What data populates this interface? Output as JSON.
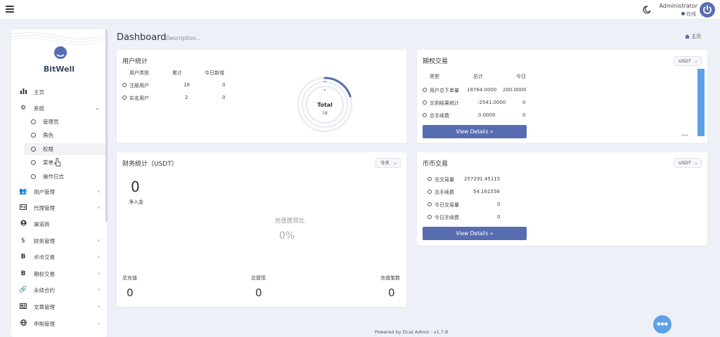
{
  "header": {
    "user_name": "Administrator",
    "user_status": "在线"
  },
  "sidebar": {
    "brand": "BitWell",
    "items": [
      {
        "icon": "bar-chart-icon",
        "label": "主页"
      },
      {
        "icon": "gear-icon",
        "label": "系统"
      },
      {
        "icon": "users-icon",
        "label": "用户管理"
      },
      {
        "icon": "id-card-icon",
        "label": "代理管理"
      },
      {
        "icon": "user-circle-icon",
        "label": "渠道商"
      },
      {
        "icon": "dollar-icon",
        "label": "财务管理"
      },
      {
        "icon": "bitcoin-icon",
        "label": "币币交易"
      },
      {
        "icon": "bitcoin-icon",
        "label": "期权交易"
      },
      {
        "icon": "link-icon",
        "label": "永续合约"
      },
      {
        "icon": "newspaper-icon",
        "label": "文章管理"
      },
      {
        "icon": "globe-icon",
        "label": "申购管理"
      }
    ],
    "sub_items": [
      {
        "label": "管理员"
      },
      {
        "label": "角色"
      },
      {
        "label": "权限"
      },
      {
        "label": "菜单"
      },
      {
        "label": "操作日志"
      }
    ]
  },
  "page": {
    "title": "Dashboard",
    "description": "Description...",
    "breadcrumb": "主页"
  },
  "user_stats": {
    "title": "用户统计",
    "headers": [
      "用户类型",
      "累计",
      "今日新增"
    ],
    "rows": [
      {
        "type": "注册用户",
        "total": "18",
        "today": "0"
      },
      {
        "type": "实名用户",
        "total": "2",
        "today": "0"
      }
    ],
    "donut_label": "Total",
    "donut_value": "18",
    "donut_fill_fraction": 0.2
  },
  "options_trade": {
    "title": "期权交易",
    "select": "USDT",
    "headers": [
      "类型",
      "总计",
      "今日"
    ],
    "rows": [
      {
        "type": "用户总下单量",
        "total": "18784.0000",
        "today": "200.0000"
      },
      {
        "type": "交割结果统计",
        "total": "-2541.0000",
        "today": "0"
      },
      {
        "type": "总手续费",
        "total": "0.0000",
        "today": "0"
      }
    ],
    "button": "View Details »"
  },
  "finance": {
    "title": "财务统计（USDT）",
    "select": "今天",
    "net_value": "0",
    "net_label": "净入金",
    "ratio_label": "充值提现比",
    "ratio_value": "0%",
    "bottom": [
      {
        "label": "总充值",
        "value": "0"
      },
      {
        "label": "总提现",
        "value": "0"
      },
      {
        "label": "充值笔数",
        "value": "0"
      }
    ]
  },
  "coin_trade": {
    "title": "币币交易",
    "select": "USDT",
    "rows": [
      {
        "label": "总交易量",
        "value": "257291.45115"
      },
      {
        "label": "总手续费",
        "value": "54.161556"
      },
      {
        "label": "今日交易量",
        "value": "0"
      },
      {
        "label": "今日手续费",
        "value": "0"
      }
    ],
    "button": "View Details »"
  },
  "footer": {
    "text": "Powered by Dcat Admin · v1.7.8"
  },
  "colors": {
    "primary": "#586cb1",
    "bar": "#5fa0e6",
    "background": "#eef0f8"
  }
}
